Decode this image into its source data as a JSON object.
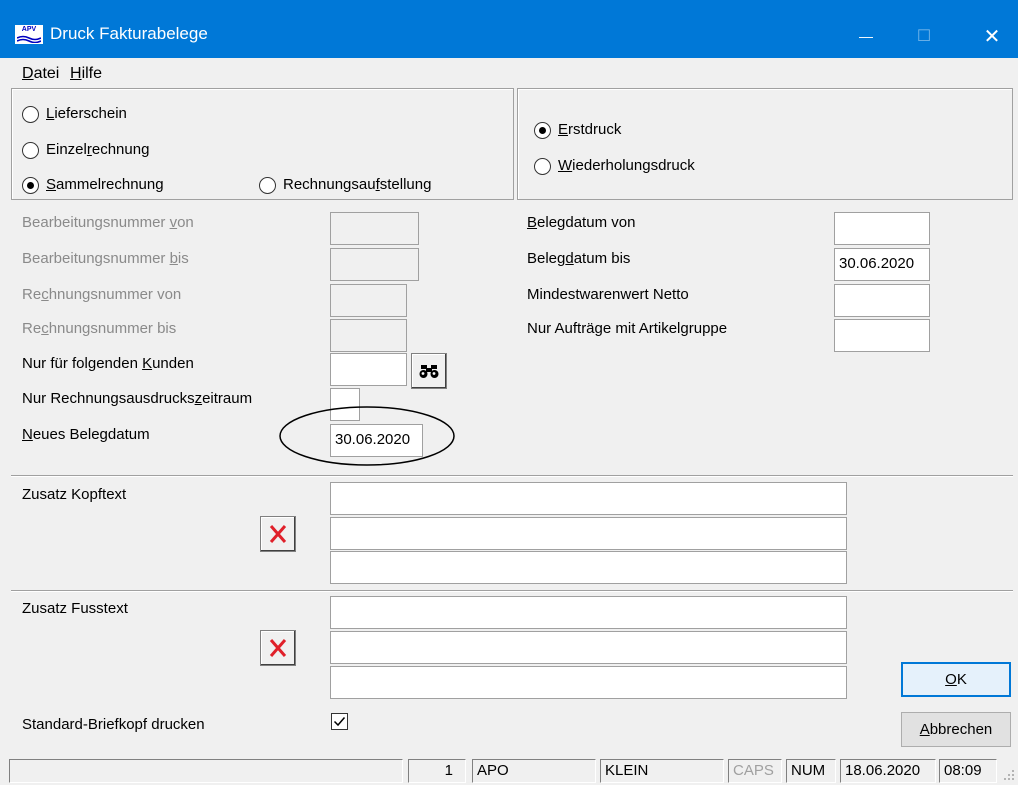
{
  "window": {
    "title": "Druck Fakturabelege",
    "icon_text": "APV",
    "minimize_glyph": "—",
    "maximize_glyph": "☐",
    "close_glyph": "✕"
  },
  "menu": [
    {
      "label": "Datei",
      "mnemonic": "D",
      "rest": "atei"
    },
    {
      "label": "Hilfe",
      "mnemonic": "H",
      "rest": "ilfe"
    }
  ],
  "document_type": {
    "options": [
      {
        "pre": "",
        "mn": "L",
        "post": "ieferschein",
        "checked": false
      },
      {
        "pre": "Einzel",
        "mn": "r",
        "post": "echnung",
        "checked": false
      },
      {
        "pre": "",
        "mn": "S",
        "post": "ammelrechnung",
        "checked": true
      },
      {
        "pre": "Rechnungsau",
        "mn": "f",
        "post": "stellung",
        "checked": false
      }
    ]
  },
  "print_mode": {
    "options": [
      {
        "pre": "",
        "mn": "E",
        "post": "rstdruck",
        "checked": true
      },
      {
        "pre": "",
        "mn": "W",
        "post": "iederholungsdruck",
        "checked": false
      }
    ]
  },
  "left_fields": [
    {
      "pre": "Bearbeitungsnummer ",
      "mn": "v",
      "post": "on",
      "value": "",
      "disabled": true
    },
    {
      "pre": "Bearbeitungsnummer ",
      "mn": "b",
      "post": "is",
      "value": "",
      "disabled": true
    },
    {
      "pre": "Re",
      "mn": "c",
      "post": "hnungsnummer von",
      "value": "",
      "disabled": true
    },
    {
      "pre": "Re",
      "mn": "c",
      "post": "hnungsnummer bis",
      "value": "",
      "disabled": true
    },
    {
      "pre": "Nur für folgenden ",
      "mn": "K",
      "post": "unden",
      "value": "",
      "disabled": false
    },
    {
      "pre": "Nur Rechnungsausdrucks",
      "mn": "z",
      "post": "eitraum",
      "value": "",
      "disabled": false
    },
    {
      "pre": "",
      "mn": "N",
      "post": "eues Belegdatum",
      "value": "30.06.2020",
      "disabled": false
    }
  ],
  "right_fields": [
    {
      "pre": "",
      "mn": "B",
      "post": "elegdatum von",
      "value": ""
    },
    {
      "pre": "Beleg",
      "mn": "d",
      "post": "atum bis",
      "value": "30.06.2020"
    },
    {
      "pre": "Mindestwarenwert Netto",
      "mn": "",
      "post": "",
      "value": ""
    },
    {
      "pre": "Nur Aufträge mit Artikelgruppe",
      "mn": "",
      "post": "",
      "value": ""
    }
  ],
  "header_text": {
    "label": "Zusatz Kopftext",
    "lines": [
      "",
      "",
      ""
    ]
  },
  "footer_text": {
    "label": "Zusatz Fusstext",
    "lines": [
      "",
      "",
      ""
    ]
  },
  "letterhead": {
    "label": "Standard-Briefkopf drucken",
    "checked": true
  },
  "buttons": {
    "ok": {
      "mn": "O",
      "post": "K"
    },
    "cancel": {
      "mn": "A",
      "post": "bbrechen"
    }
  },
  "statusbar": {
    "cells": [
      "",
      "1",
      "APO",
      "KLEIN",
      "CAPS",
      "NUM",
      "18.06.2020",
      "08:09"
    ]
  },
  "icons": {
    "search": "binoculars-icon",
    "clear": "red-x-icon"
  },
  "colors": {
    "titlebar": "#0078d7",
    "clear_x": "#e0202a",
    "default_button_border": "#0078d7"
  }
}
